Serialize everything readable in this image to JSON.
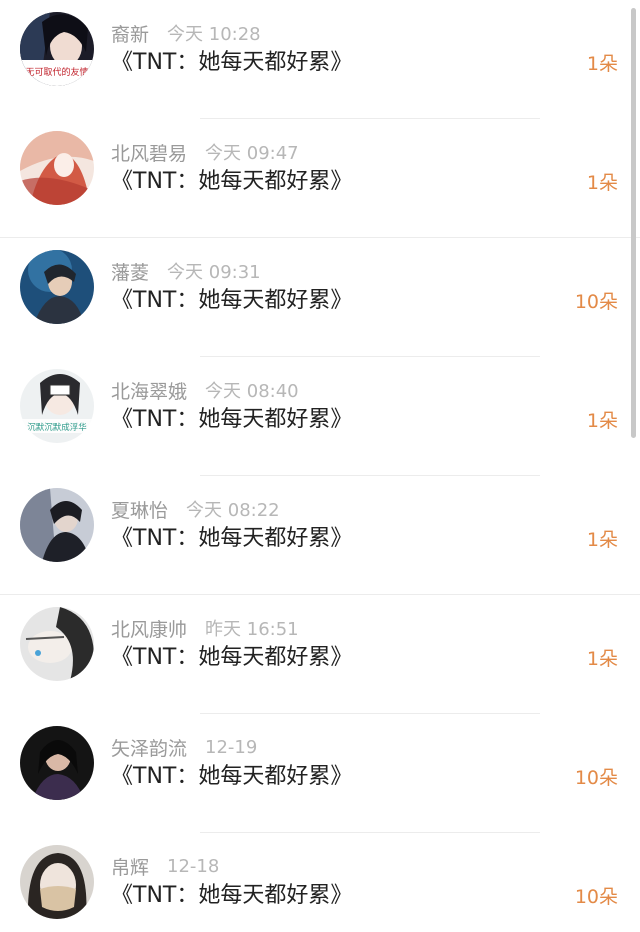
{
  "messages": [
    {
      "name": "裔新",
      "time": "今天 10:28",
      "title": "《TNT：她每天都好累》",
      "gift": "1朵",
      "avatar_caption": "无可取代的友情"
    },
    {
      "name": "北风碧易",
      "time": "今天 09:47",
      "title": "《TNT：她每天都好累》",
      "gift": "1朵"
    },
    {
      "name": "藩菱",
      "time": "今天 09:31",
      "title": "《TNT：她每天都好累》",
      "gift": "10朵"
    },
    {
      "name": "北海翠娥",
      "time": "今天 08:40",
      "title": "《TNT：她每天都好累》",
      "gift": "1朵",
      "avatar_caption": "沉默沉默成浮华"
    },
    {
      "name": "夏琳怡",
      "time": "今天 08:22",
      "title": "《TNT：她每天都好累》",
      "gift": "1朵"
    },
    {
      "name": "北风康帅",
      "time": "昨天 16:51",
      "title": "《TNT：她每天都好累》",
      "gift": "1朵"
    },
    {
      "name": "矢泽韵流",
      "time": "12-19",
      "title": "《TNT：她每天都好累》",
      "gift": "10朵"
    },
    {
      "name": "帛辉",
      "time": "12-18",
      "title": "《TNT：她每天都好累》",
      "gift": "10朵"
    }
  ]
}
